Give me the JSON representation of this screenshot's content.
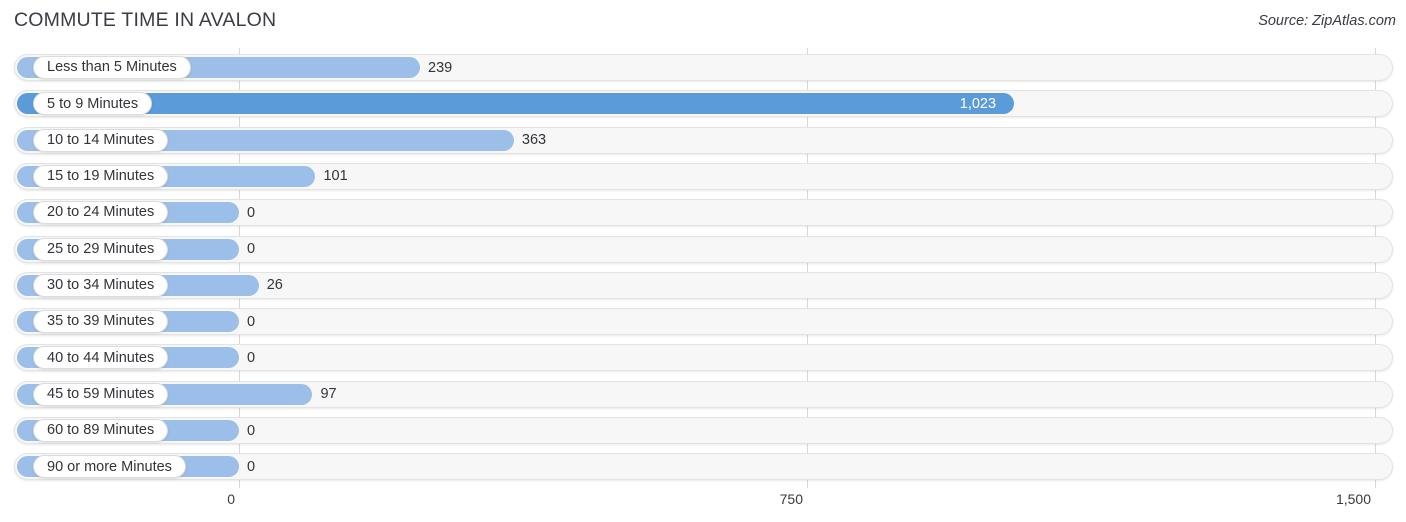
{
  "header": {
    "title": "COMMUTE TIME IN AVALON",
    "source": "Source: ZipAtlas.com"
  },
  "chart_data": {
    "type": "bar",
    "orientation": "horizontal",
    "title": "COMMUTE TIME IN AVALON",
    "subtitle": "",
    "xlabel": "",
    "ylabel": "",
    "xlim": [
      0,
      1500
    ],
    "grid": true,
    "legend": null,
    "source": "Source: ZipAtlas.com",
    "xticks": [
      "0",
      "750",
      "1,500"
    ],
    "xtick_values": [
      0,
      750,
      1500
    ],
    "categories": [
      "Less than 5 Minutes",
      "5 to 9 Minutes",
      "10 to 14 Minutes",
      "15 to 19 Minutes",
      "20 to 24 Minutes",
      "25 to 29 Minutes",
      "30 to 34 Minutes",
      "35 to 39 Minutes",
      "40 to 44 Minutes",
      "45 to 59 Minutes",
      "60 to 89 Minutes",
      "90 or more Minutes"
    ],
    "values": [
      239,
      1023,
      363,
      101,
      0,
      0,
      26,
      0,
      0,
      97,
      0,
      0
    ],
    "value_labels": [
      "239",
      "1,023",
      "363",
      "101",
      "0",
      "0",
      "26",
      "0",
      "0",
      "97",
      "0",
      "0"
    ],
    "highlight_index": 1,
    "colors": {
      "bar": "#9bbfe8",
      "bar_highlight": "#5b9bd9",
      "track": "#f7f7f7",
      "gridline": "#d8d8d8",
      "text": "#33333a"
    }
  },
  "rows": [
    {
      "label": "Less than 5 Minutes",
      "value_label": "239"
    },
    {
      "label": "5 to 9 Minutes",
      "value_label": "1,023"
    },
    {
      "label": "10 to 14 Minutes",
      "value_label": "363"
    },
    {
      "label": "15 to 19 Minutes",
      "value_label": "101"
    },
    {
      "label": "20 to 24 Minutes",
      "value_label": "0"
    },
    {
      "label": "25 to 29 Minutes",
      "value_label": "0"
    },
    {
      "label": "30 to 34 Minutes",
      "value_label": "26"
    },
    {
      "label": "35 to 39 Minutes",
      "value_label": "0"
    },
    {
      "label": "40 to 44 Minutes",
      "value_label": "0"
    },
    {
      "label": "45 to 59 Minutes",
      "value_label": "97"
    },
    {
      "label": "60 to 89 Minutes",
      "value_label": "0"
    },
    {
      "label": "90 or more Minutes",
      "value_label": "0"
    }
  ],
  "axis": {
    "ticks": [
      {
        "label": "0"
      },
      {
        "label": "750"
      },
      {
        "label": "1,500"
      }
    ]
  }
}
